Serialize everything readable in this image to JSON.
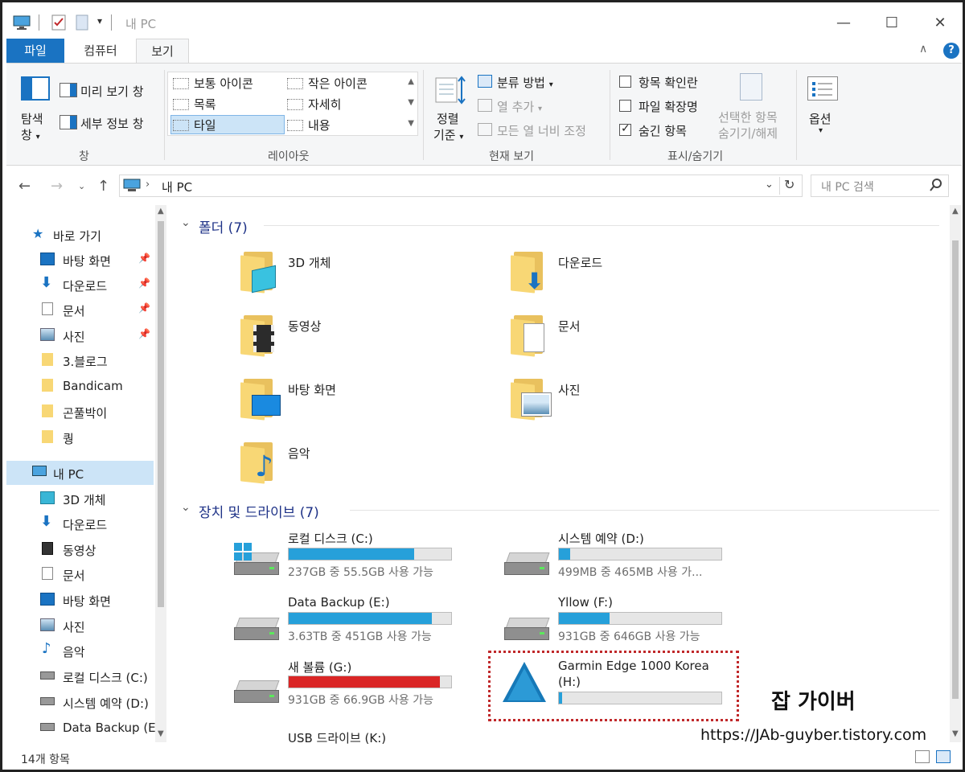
{
  "window": {
    "title": "내 PC"
  },
  "ribbon": {
    "tabs": [
      "파일",
      "컴퓨터",
      "보기"
    ],
    "pane_group": {
      "nav_pane_label": "탐색",
      "nav_pane_label2": "창",
      "preview_label": "미리 보기 창",
      "details_label": "세부 정보 창",
      "group_label": "창"
    },
    "layout_group": {
      "items": [
        "보통 아이콘",
        "작은 아이콘",
        "목록",
        "자세히",
        "타일",
        "내용"
      ],
      "group_label": "레이아웃"
    },
    "current_view_group": {
      "sort_label1": "정렬",
      "sort_label2": "기준",
      "group_by": "분류 방법",
      "add_columns": "열 추가",
      "size_columns": "모든 열 너비 조정",
      "group_label": "현재 보기"
    },
    "show_hide_group": {
      "item_checkboxes": "항목 확인란",
      "file_extensions": "파일 확장명",
      "hidden_items": "숨긴 항목",
      "hide_selected1": "선택한 항목",
      "hide_selected2": "숨기기/해제",
      "group_label": "표시/숨기기"
    },
    "options_label": "옵션"
  },
  "address": {
    "path": "내 PC",
    "search_placeholder": "내 PC 검색"
  },
  "nav_pane": {
    "quick_access": "바로 가기",
    "items": [
      {
        "label": "바탕 화면",
        "pinned": true
      },
      {
        "label": "다운로드",
        "pinned": true
      },
      {
        "label": "문서",
        "pinned": true
      },
      {
        "label": "사진",
        "pinned": true
      },
      {
        "label": "3.블로그",
        "pinned": false
      },
      {
        "label": "Bandicam",
        "pinned": false
      },
      {
        "label": "곤풀박이",
        "pinned": false
      },
      {
        "label": "퀑",
        "pinned": false
      }
    ],
    "this_pc": "내 PC",
    "pc_items": [
      "3D 개체",
      "다운로드",
      "동영상",
      "문서",
      "바탕 화면",
      "사진",
      "음악",
      "로컬 디스크 (C:)",
      "시스템 예약 (D:)",
      "Data Backup (E:)"
    ]
  },
  "folders_section": {
    "heading": "폴더 (7)",
    "folders": [
      "3D 개체",
      "다운로드",
      "동영상",
      "문서",
      "바탕 화면",
      "사진",
      "음악"
    ]
  },
  "drives_section": {
    "heading": "장치 및 드라이브 (7)",
    "drives": [
      {
        "name": "로컬 디스크 (C:)",
        "free": "237GB 중 55.5GB 사용 가능",
        "used_fraction": 0.77
      },
      {
        "name": "시스템 예약 (D:)",
        "free": "499MB 중 465MB 사용 가...",
        "used_fraction": 0.07
      },
      {
        "name": "Data Backup (E:)",
        "free": "3.63TB 중 451GB 사용 가능",
        "used_fraction": 0.88
      },
      {
        "name": "Yllow (F:)",
        "free": "931GB 중 646GB 사용 가능",
        "used_fraction": 0.31
      },
      {
        "name": "새 볼륨 (G:)",
        "free": "931GB 중 66.9GB 사용 가능",
        "used_fraction": 0.93
      },
      {
        "name": "Garmin Edge 1000 Korea",
        "name2": "(H:)",
        "used_fraction": 0.02
      },
      {
        "name": "USB 드라이브 (K:)"
      }
    ]
  },
  "status": {
    "item_count": "14개 항목"
  },
  "watermark": {
    "title": "잡 가이버",
    "url": "https://JAb-guyber.tistory.com"
  },
  "colors": {
    "accent": "#1a73c2",
    "bar": "#26a0da",
    "bar_full": "#da2626",
    "highlight": "#c0282a"
  }
}
